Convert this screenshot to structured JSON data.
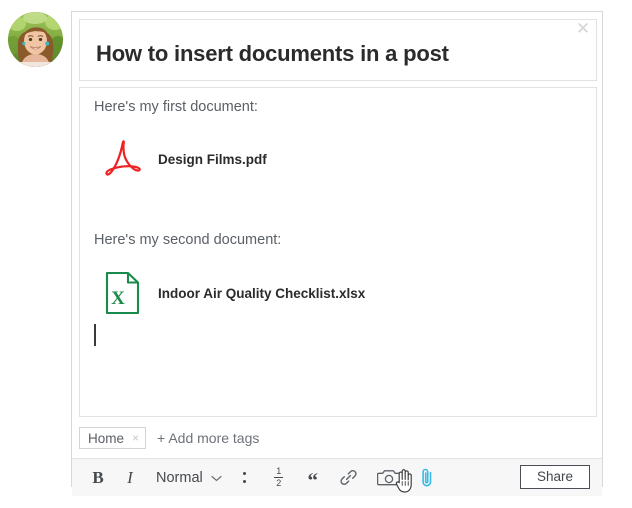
{
  "avatar": {
    "name": "user-profile-photo",
    "alt": "Profile photo of smiling woman outdoors"
  },
  "composer": {
    "title": "How to insert documents in a post",
    "close_label": "✕",
    "body": {
      "line1": "Here's my first document:",
      "line2": "Here's my second document:",
      "attachments": [
        {
          "filename": "Design Films.pdf",
          "type": "pdf",
          "icon": "adobe-pdf-icon",
          "color": "#ee2222"
        },
        {
          "filename": "Indoor Air Quality Checklist.xlsx",
          "type": "xlsx",
          "icon": "excel-file-icon",
          "color": "#1a8a4c"
        }
      ]
    },
    "tags": {
      "items": [
        {
          "label": "Home",
          "remove_label": "×"
        }
      ],
      "add_label": "+ Add more tags"
    },
    "toolbar": {
      "bold_label": "B",
      "italic_label": "I",
      "style_label": "Normal",
      "style_chevron": "⌄",
      "bullet_list_label": "bullet-list",
      "numbered_list_top": "1",
      "numbered_list_bottom": "2",
      "quote_label": "“",
      "link_label": "link",
      "camera_label": "camera",
      "attach_label": "paperclip",
      "attach_active_color": "#35b9e8"
    },
    "share_label": "Share"
  }
}
